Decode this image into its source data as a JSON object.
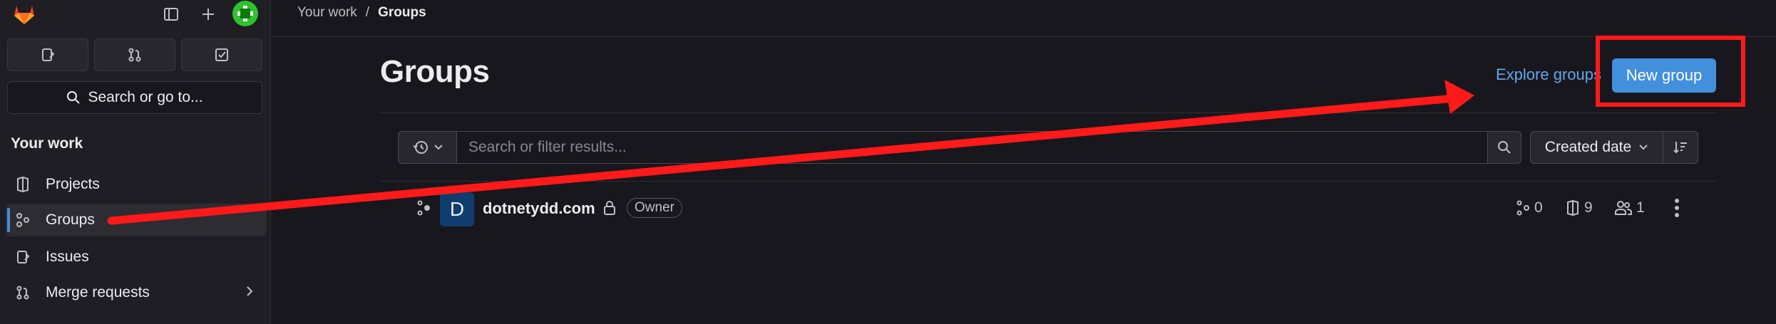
{
  "sidebar": {
    "search_label": "Search or go to...",
    "section_title": "Your work",
    "items": [
      {
        "label": "Projects"
      },
      {
        "label": "Groups"
      },
      {
        "label": "Issues"
      },
      {
        "label": "Merge requests"
      }
    ]
  },
  "breadcrumb": {
    "parent": "Your work",
    "separator": "/",
    "current": "Groups"
  },
  "page": {
    "title": "Groups",
    "explore_label": "Explore groups",
    "new_group_label": "New group"
  },
  "filter": {
    "placeholder": "Search or filter results...",
    "sort_label": "Created date"
  },
  "groups": [
    {
      "avatar_letter": "D",
      "name": "dotnetydd.com",
      "role": "Owner",
      "subgroups": "0",
      "projects": "9",
      "members": "1"
    }
  ],
  "colors": {
    "accent": "#428fdc",
    "annotation": "#ff1a1a",
    "link": "#63a6e9"
  }
}
